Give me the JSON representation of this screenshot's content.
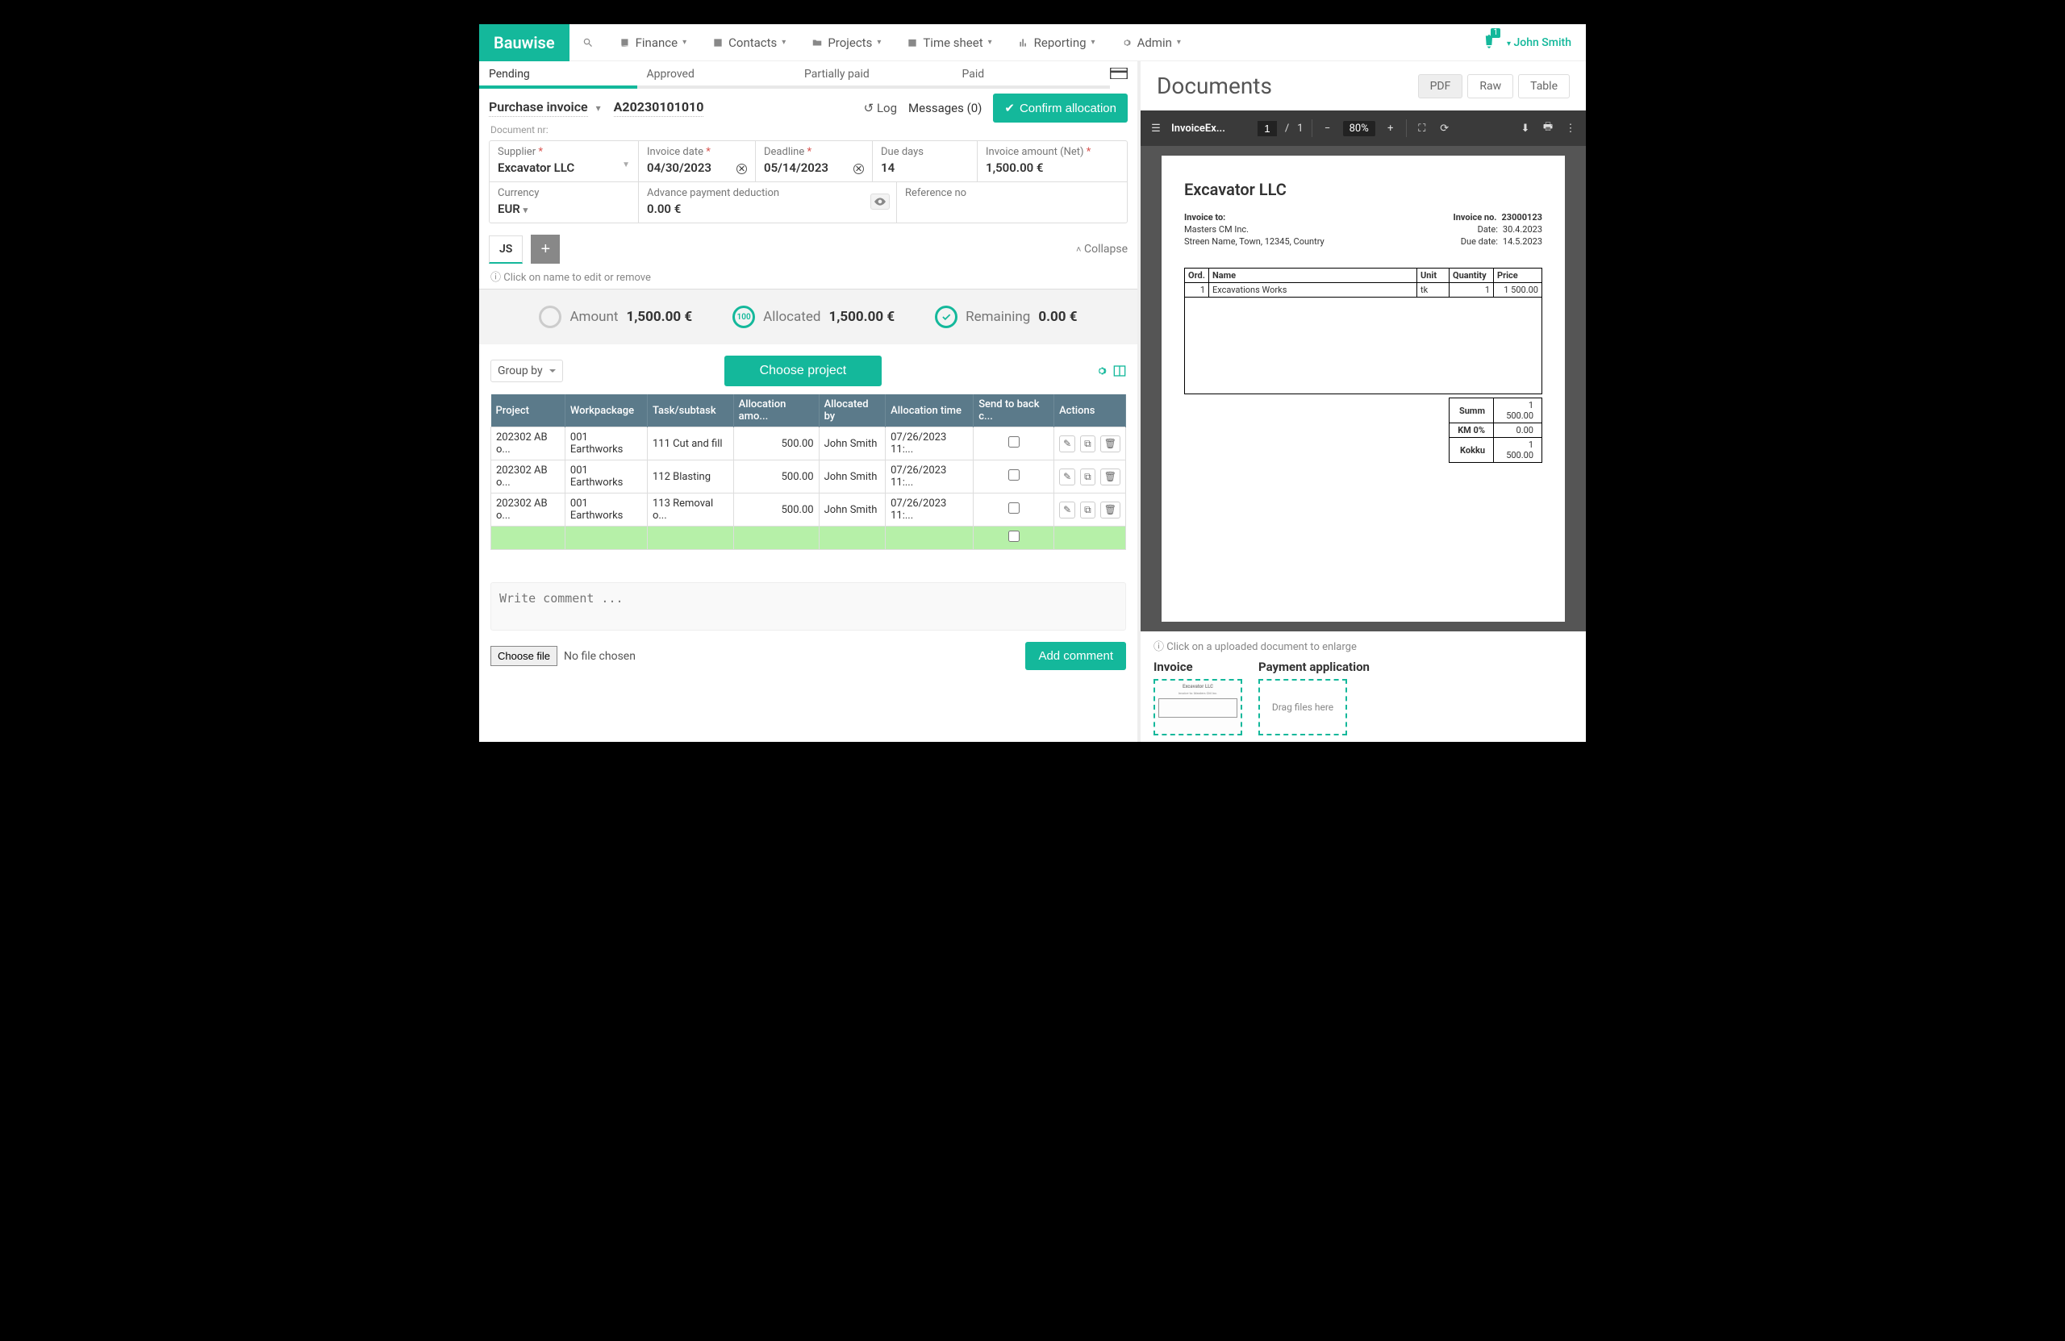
{
  "brand": "Bauwise",
  "nav": [
    "Finance",
    "Contacts",
    "Projects",
    "Time sheet",
    "Reporting",
    "Admin"
  ],
  "user": "John Smith",
  "notification_count": "1",
  "status_tabs": [
    "Pending",
    "Approved",
    "Partially paid",
    "Paid"
  ],
  "doc_type": "Purchase invoice",
  "doc_number": "A20230101010",
  "log_label": "Log",
  "messages_label": "Messages (0)",
  "confirm_label": "Confirm allocation",
  "doc_nr_label": "Document nr:",
  "form": {
    "supplier_label": "Supplier",
    "supplier": "Excavator LLC",
    "invoice_date_label": "Invoice date",
    "invoice_date": "04/30/2023",
    "deadline_label": "Deadline",
    "deadline": "05/14/2023",
    "due_days_label": "Due days",
    "due_days": "14",
    "amount_label": "Invoice amount (Net)",
    "amount": "1,500.00 €",
    "currency_label": "Currency",
    "currency": "EUR",
    "advance_label": "Advance payment deduction",
    "advance": "0.00 €",
    "ref_label": "Reference no"
  },
  "mini_tab": "JS",
  "collapse_label": "Collapse",
  "hint": "Click on name to edit or remove",
  "summary": {
    "amount_label": "Amount",
    "amount": "1,500.00 €",
    "allocated_label": "Allocated",
    "allocated": "1,500.00 €",
    "remaining_label": "Remaining",
    "remaining": "0.00 €"
  },
  "groupby_label": "Group by",
  "choose_project_label": "Choose project",
  "table": {
    "headers": [
      "Project",
      "Workpackage",
      "Task/subtask",
      "Allocation amo...",
      "Allocated by",
      "Allocation time",
      "Send to back c...",
      "Actions"
    ],
    "rows": [
      {
        "project": "202302 AB o...",
        "wp": "001 Earthworks",
        "task": "111 Cut and fill",
        "amount": "500.00",
        "by": "John Smith",
        "time": "07/26/2023 11:..."
      },
      {
        "project": "202302 AB o...",
        "wp": "001 Earthworks",
        "task": "112 Blasting",
        "amount": "500.00",
        "by": "John Smith",
        "time": "07/26/2023 11:..."
      },
      {
        "project": "202302 AB o...",
        "wp": "001 Earthworks",
        "task": "113 Removal o...",
        "amount": "500.00",
        "by": "John Smith",
        "time": "07/26/2023 11:..."
      }
    ]
  },
  "comment_placeholder": "Write comment ...",
  "choose_file_label": "Choose file",
  "no_file_label": "No file chosen",
  "add_comment_label": "Add comment",
  "docs": {
    "title": "Documents",
    "views": [
      "PDF",
      "Raw",
      "Table"
    ],
    "filename": "InvoiceEx...",
    "page_current": "1",
    "page_total": "1",
    "zoom": "80%",
    "hint": "Click on a uploaded document to enlarge",
    "section_invoice": "Invoice",
    "section_payment": "Payment application",
    "drag_label": "Drag files here"
  },
  "pdf": {
    "company": "Excavator LLC",
    "invoice_to_label": "Invoice to:",
    "bill_to1": "Masters CM Inc.",
    "bill_to2": "Streen Name, Town, 12345, Country",
    "invno_label": "Invoice no.",
    "invno": "23000123",
    "date_label": "Date:",
    "date": "30.4.2023",
    "due_label": "Due date:",
    "due": "14.5.2023",
    "headers": [
      "Ord.",
      "Name",
      "Unit",
      "Quantity",
      "Price"
    ],
    "item": {
      "ord": "1",
      "name": "Excavations Works",
      "unit": "tk",
      "qty": "1",
      "price": "1 500.00"
    },
    "totals": [
      {
        "label": "Summ",
        "value": "1 500.00"
      },
      {
        "label": "KM 0%",
        "value": "0.00"
      },
      {
        "label": "Kokku",
        "value": "1 500.00"
      }
    ]
  }
}
